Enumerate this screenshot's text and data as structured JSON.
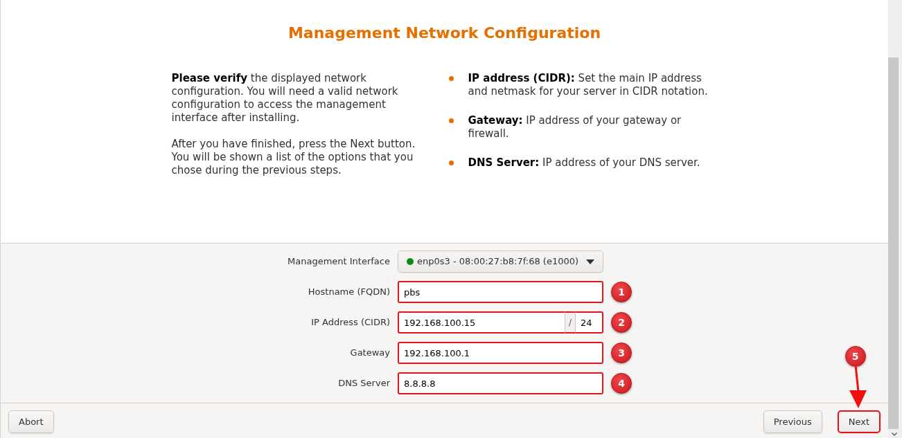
{
  "title": "Management Network Configuration",
  "intro": {
    "paragraphs": [
      "**Please verify** the displayed network configuration. You will need a valid network configuration to access the management interface after installing.",
      "After you have finished, press the Next button. You will be shown a list of the options that you chose during the previous steps."
    ]
  },
  "help_items": [
    "**IP address (CIDR):** Set the main IP address and netmask for your server in CIDR notation.",
    "**Gateway:** IP address of your gateway or firewall.",
    "**DNS Server:** IP address of your DNS server."
  ],
  "form": {
    "fields": [
      {
        "kind": "select",
        "label": "Management Interface",
        "value": "enp0s3 - 08:00:27:b8:7f:68 (e1000)",
        "link_up": true,
        "highlighted": false
      },
      {
        "kind": "text",
        "label": "Hostname (FQDN)",
        "value": "pbs",
        "highlighted": true,
        "marker": "1"
      },
      {
        "kind": "cidr",
        "label": "IP Address (CIDR)",
        "value": "192.168.100.15",
        "separator": "/",
        "netmask": "24",
        "highlighted": true,
        "marker": "2"
      },
      {
        "kind": "text",
        "label": "Gateway",
        "value": "192.168.100.1",
        "highlighted": true,
        "marker": "3"
      },
      {
        "kind": "text",
        "label": "DNS Server",
        "value": "8.8.8.8",
        "highlighted": true,
        "marker": "4"
      }
    ]
  },
  "footer": {
    "left_buttons": [
      {
        "label": "Abort",
        "highlighted": false
      }
    ],
    "right_buttons": [
      {
        "label": "Previous",
        "highlighted": false
      },
      {
        "label": "Next",
        "highlighted": true,
        "marker": "5"
      }
    ]
  }
}
